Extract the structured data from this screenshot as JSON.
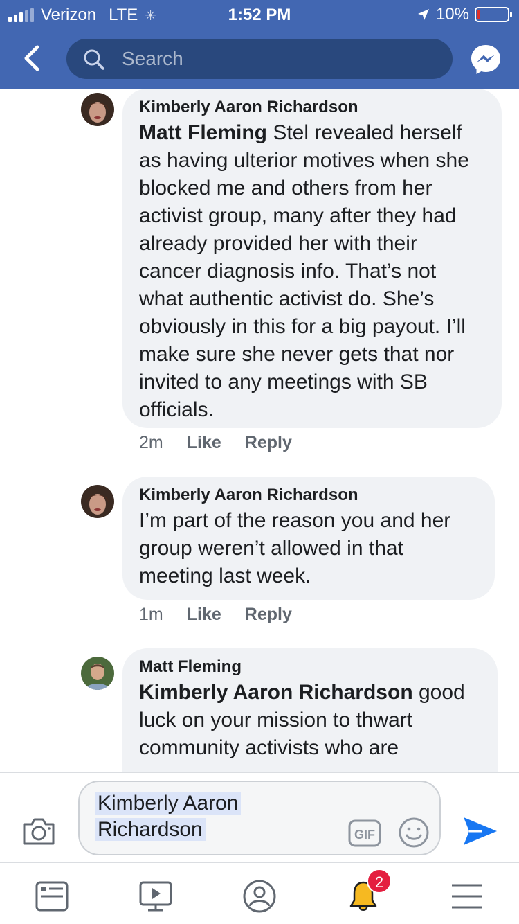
{
  "status_bar": {
    "carrier": "Verizon",
    "network": "LTE",
    "time": "1:52 PM",
    "battery": "10%"
  },
  "nav": {
    "search_placeholder": "Search"
  },
  "colors": {
    "brand": "#4267b2",
    "send": "#1877f2",
    "badge": "#e41e3f"
  },
  "comments": [
    {
      "author": "Kimberly Aaron Richardson",
      "mention": "Matt Fleming",
      "text": " Stel revealed herself as having ulterior motives when she blocked me and others from her activist group, many after they had already provided her with their cancer diagnosis info. That’s not what authentic activist do. She’s obviously in this for a big payout. I’ll make sure she never gets that nor invited to any meetings with SB officials.",
      "time": "2m",
      "like": "Like",
      "reply": "Reply"
    },
    {
      "author": "Kimberly Aaron Richardson",
      "mention": "",
      "text": "I’m part of the reason you and her group weren’t allowed in that meeting last week.",
      "time": "1m",
      "like": "Like",
      "reply": "Reply"
    },
    {
      "author": "Matt Fleming",
      "mention": "Kimberly Aaron Richardson",
      "text": " good luck on your mission to thwart community activists who are"
    }
  ],
  "composer": {
    "typed_line1": "Kimberly Aaron",
    "typed_line2": "Richardson",
    "gif_label": "GIF"
  },
  "tabbar": {
    "notification_count": "2",
    "icons": [
      "news-feed-icon",
      "watch-icon",
      "profile-icon",
      "notifications-bell-icon",
      "menu-icon"
    ]
  }
}
